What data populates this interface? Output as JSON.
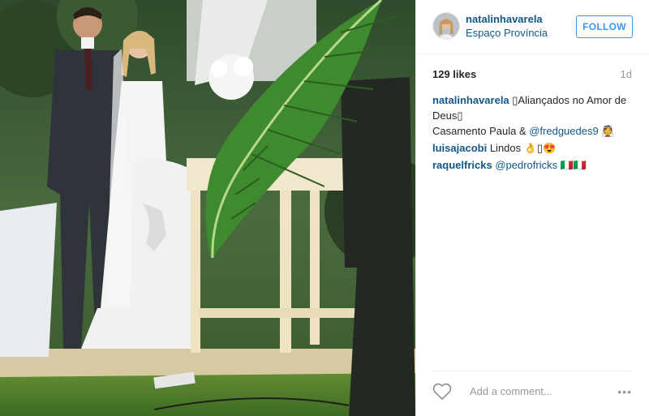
{
  "header": {
    "username": "natalinhavarela",
    "location": "Espaço Província",
    "follow_label": "FOLLOW"
  },
  "stats": {
    "likes": "129 likes",
    "time": "1d"
  },
  "comments": [
    {
      "user": "natalinhavarela",
      "text": "▯Aliançados no Amor de Deus▯",
      "line2": "Casamento Paula & ",
      "mention": "@fredguedes9",
      "emoji": "👰"
    },
    {
      "user": "luisajacobi",
      "text": "Lindos 👌▯😍"
    },
    {
      "user": "raquelfricks",
      "mention": "@pedrofricks",
      "emoji": "🇮🇹🇮🇹"
    }
  ],
  "footer": {
    "comment_placeholder": "Add a comment...",
    "more_label": "•••"
  },
  "icons": {
    "heart": "heart-icon",
    "avatar": "avatar"
  },
  "colors": {
    "link": "#125688",
    "accent": "#3897f0",
    "muted": "#999999"
  }
}
